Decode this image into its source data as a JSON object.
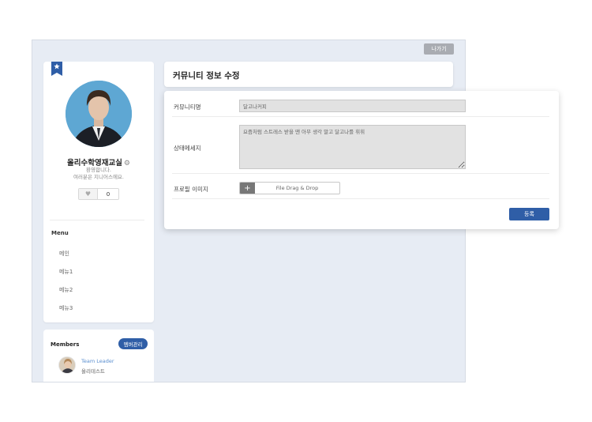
{
  "header": {
    "exit_label": "나가기"
  },
  "profile": {
    "community_name": "올리수학영재교실",
    "settings_glyph": "⚙",
    "welcome_line1": "환영합니다.",
    "welcome_line2": "여러분은 지니어스에요.",
    "like_icon": "heart-icon",
    "like_count": "0"
  },
  "menu": {
    "title": "Menu",
    "items": [
      "메인",
      "메뉴1",
      "메뉴2",
      "메뉴3"
    ]
  },
  "members": {
    "title": "Members",
    "manage_label": "멤버관리",
    "leader": {
      "role": "Team Leader",
      "name": "올리테스트"
    }
  },
  "page_title": "커뮤니티 정보 수정",
  "form": {
    "name_label": "커뮤니티명",
    "name_value": "달고나커피",
    "status_label": "상태메세지",
    "status_value": "요즘처럼 스트레스 받을 땐 아무 생각 말고 달고나를 휘휘",
    "image_label": "프로필 이미지",
    "file_plus": "+",
    "file_text": "File Drag & Drop",
    "submit_label": "등록"
  },
  "colors": {
    "accent": "#2f5ea7",
    "background": "#e7ecf4",
    "link": "#5b8fcf"
  }
}
